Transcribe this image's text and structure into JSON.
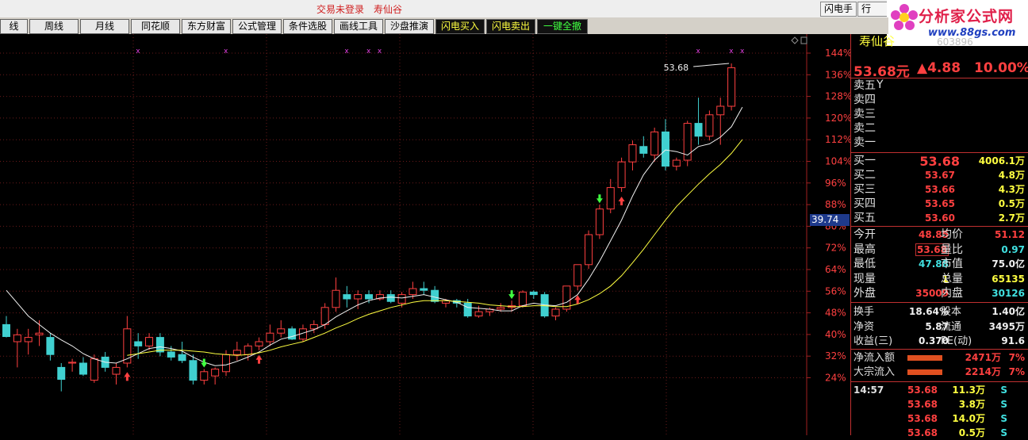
{
  "topbar": {
    "login_status": "交易未登录",
    "stock_name": "寿仙谷",
    "flash_hand_label": "闪电手",
    "row_label": "行"
  },
  "logo": {
    "name": "分析家公式网",
    "url": "www.88gs.com"
  },
  "toolbar": {
    "tabs": [
      "线",
      "周线",
      "月线",
      "同花顺",
      "东方财富",
      "公式管理",
      "条件选股",
      "画线工具",
      "沙盘推演",
      "闪电买入",
      "闪电卖出",
      "一键全撤"
    ]
  },
  "chart": {
    "current_price_label": "39.74",
    "peak_label": "53.68",
    "y_axis_pct": [
      "144%",
      "136%",
      "128%",
      "120%",
      "112%",
      "104%",
      "96%",
      "88%",
      "80%",
      "72%",
      "64%",
      "56%",
      "48%",
      "40%",
      "32%",
      "24%"
    ]
  },
  "colors": {
    "up": "#ff4040",
    "down": "#40d0d0",
    "ma5": "#f0f0f0",
    "ma10": "#ffff40",
    "grid": "#6a1a1a"
  },
  "chart_data": {
    "type": "candlestick",
    "candles": [
      {
        "o": 43.0,
        "h": 44.0,
        "l": 41.5,
        "c": 41.6
      },
      {
        "o": 41.0,
        "h": 42.5,
        "l": 38.0,
        "c": 41.8
      },
      {
        "o": 41.0,
        "h": 42.5,
        "l": 39.5,
        "c": 41.5
      },
      {
        "o": 41.8,
        "h": 43.5,
        "l": 40.5,
        "c": 42.0
      },
      {
        "o": 41.5,
        "h": 42.0,
        "l": 38.8,
        "c": 39.5
      },
      {
        "o": 38.0,
        "h": 38.5,
        "l": 35.2,
        "c": 36.6
      },
      {
        "o": 38.5,
        "h": 39.0,
        "l": 37.5,
        "c": 38.6
      },
      {
        "o": 38.5,
        "h": 39.2,
        "l": 37.0,
        "c": 37.2
      },
      {
        "o": 36.5,
        "h": 39.5,
        "l": 36.2,
        "c": 39.0
      },
      {
        "o": 39.2,
        "h": 39.8,
        "l": 37.5,
        "c": 38.0
      },
      {
        "o": 37.2,
        "h": 38.5,
        "l": 36.0,
        "c": 38.0
      },
      {
        "o": 38.5,
        "h": 44.0,
        "l": 38.0,
        "c": 42.5
      },
      {
        "o": 41.0,
        "h": 42.0,
        "l": 39.0,
        "c": 40.5
      },
      {
        "o": 40.5,
        "h": 42.0,
        "l": 40.0,
        "c": 41.5
      },
      {
        "o": 41.5,
        "h": 42.0,
        "l": 39.3,
        "c": 39.8
      },
      {
        "o": 39.8,
        "h": 40.5,
        "l": 38.8,
        "c": 39.2
      },
      {
        "o": 39.5,
        "h": 41.0,
        "l": 38.5,
        "c": 38.8
      },
      {
        "o": 38.8,
        "h": 39.5,
        "l": 36.0,
        "c": 36.5
      },
      {
        "o": 36.5,
        "h": 37.8,
        "l": 36.0,
        "c": 37.5
      },
      {
        "o": 37.0,
        "h": 38.0,
        "l": 36.0,
        "c": 37.8
      },
      {
        "o": 37.5,
        "h": 40.0,
        "l": 37.0,
        "c": 39.5
      },
      {
        "o": 39.5,
        "h": 41.0,
        "l": 38.8,
        "c": 40.0
      },
      {
        "o": 39.5,
        "h": 40.8,
        "l": 38.8,
        "c": 40.5
      },
      {
        "o": 40.5,
        "h": 41.5,
        "l": 40.0,
        "c": 41.0
      },
      {
        "o": 41.0,
        "h": 43.0,
        "l": 40.5,
        "c": 42.0
      },
      {
        "o": 42.0,
        "h": 43.5,
        "l": 41.5,
        "c": 42.5
      },
      {
        "o": 42.5,
        "h": 42.8,
        "l": 41.2,
        "c": 41.3
      },
      {
        "o": 41.3,
        "h": 43.0,
        "l": 41.0,
        "c": 42.5
      },
      {
        "o": 42.5,
        "h": 43.5,
        "l": 42.0,
        "c": 43.0
      },
      {
        "o": 43.0,
        "h": 45.5,
        "l": 42.5,
        "c": 45.0
      },
      {
        "o": 45.0,
        "h": 48.5,
        "l": 44.5,
        "c": 47.0
      },
      {
        "o": 46.5,
        "h": 47.5,
        "l": 45.0,
        "c": 46.0
      },
      {
        "o": 46.0,
        "h": 47.0,
        "l": 44.8,
        "c": 46.5
      },
      {
        "o": 46.5,
        "h": 47.0,
        "l": 45.5,
        "c": 46.0
      },
      {
        "o": 46.0,
        "h": 47.0,
        "l": 45.8,
        "c": 46.5
      },
      {
        "o": 46.5,
        "h": 47.0,
        "l": 45.5,
        "c": 45.7
      },
      {
        "o": 45.5,
        "h": 46.8,
        "l": 45.0,
        "c": 46.5
      },
      {
        "o": 46.5,
        "h": 48.0,
        "l": 46.0,
        "c": 47.2
      },
      {
        "o": 47.2,
        "h": 48.0,
        "l": 46.5,
        "c": 47.0
      },
      {
        "o": 47.0,
        "h": 47.5,
        "l": 45.5,
        "c": 45.7
      },
      {
        "o": 45.5,
        "h": 46.0,
        "l": 45.0,
        "c": 45.8
      },
      {
        "o": 45.8,
        "h": 46.0,
        "l": 45.0,
        "c": 45.5
      },
      {
        "o": 45.5,
        "h": 46.0,
        "l": 43.8,
        "c": 44.0
      },
      {
        "o": 44.0,
        "h": 45.2,
        "l": 43.8,
        "c": 44.5
      },
      {
        "o": 44.5,
        "h": 45.0,
        "l": 44.0,
        "c": 44.8
      },
      {
        "o": 44.8,
        "h": 45.5,
        "l": 44.5,
        "c": 45.0
      },
      {
        "o": 45.0,
        "h": 45.8,
        "l": 44.5,
        "c": 45.2
      },
      {
        "o": 45.2,
        "h": 47.0,
        "l": 45.0,
        "c": 46.8
      },
      {
        "o": 46.8,
        "h": 47.0,
        "l": 46.0,
        "c": 46.5
      },
      {
        "o": 46.5,
        "h": 46.8,
        "l": 43.8,
        "c": 44.0
      },
      {
        "o": 44.0,
        "h": 45.0,
        "l": 43.5,
        "c": 44.8
      },
      {
        "o": 44.8,
        "h": 47.5,
        "l": 44.5,
        "c": 47.5
      },
      {
        "o": 47.5,
        "h": 50.0,
        "l": 47.0,
        "c": 50.0
      },
      {
        "o": 50.0,
        "h": 54.0,
        "l": 49.5,
        "c": 53.5
      },
      {
        "o": 53.5,
        "h": 57.0,
        "l": 53.0,
        "c": 56.5
      },
      {
        "o": 56.5,
        "h": 60.0,
        "l": 56.0,
        "c": 59.0
      },
      {
        "o": 59.0,
        "h": 62.5,
        "l": 58.5,
        "c": 62.0
      },
      {
        "o": 62.0,
        "h": 64.5,
        "l": 61.0,
        "c": 64.0
      },
      {
        "o": 63.8,
        "h": 65.0,
        "l": 62.5,
        "c": 63.0
      },
      {
        "o": 62.8,
        "h": 66.0,
        "l": 62.0,
        "c": 65.5
      },
      {
        "o": 65.5,
        "h": 67.0,
        "l": 61.0,
        "c": 61.5
      },
      {
        "o": 61.5,
        "h": 62.5,
        "l": 61.0,
        "c": 62.2
      },
      {
        "o": 62.2,
        "h": 66.8,
        "l": 61.5,
        "c": 66.5
      },
      {
        "o": 66.5,
        "h": 69.5,
        "l": 64.0,
        "c": 65.0
      },
      {
        "o": 65.0,
        "h": 68.0,
        "l": 64.5,
        "c": 67.5
      },
      {
        "o": 67.5,
        "h": 69.5,
        "l": 64.0,
        "c": 68.5
      },
      {
        "o": 68.5,
        "h": 73.5,
        "l": 68.0,
        "c": 73.0
      }
    ],
    "ma5": [
      47,
      45.5,
      44,
      43,
      42,
      41.2,
      40.5,
      39.6,
      39.0,
      38.6,
      38.5,
      39.0,
      39.6,
      40.2,
      40.4,
      40.2,
      39.9,
      39.2,
      38.6,
      38.2,
      38.3,
      38.7,
      39.2,
      39.8,
      40.6,
      41.3,
      41.6,
      42.0,
      42.4,
      43.0,
      43.9,
      44.6,
      45.3,
      45.8,
      46.1,
      46.2,
      46.1,
      46.3,
      46.5,
      46.2,
      45.9,
      45.6,
      45.0,
      44.9,
      44.8,
      44.6,
      44.6,
      45.2,
      45.5,
      45.3,
      45.2,
      45.6,
      46.5,
      48.3,
      50.4,
      52.8,
      55.2,
      58.0,
      60.5,
      62.2,
      63.4,
      63.2,
      62.8,
      63.8,
      64.1,
      64.9,
      66.1,
      68.4
    ],
    "ma10": [
      null,
      null,
      null,
      null,
      null,
      null,
      null,
      null,
      null,
      null,
      null,
      39.4,
      39.6,
      39.8,
      40.0,
      40.0,
      40.0,
      39.9,
      39.8,
      39.6,
      39.5,
      39.4,
      39.5,
      39.7,
      40.0,
      40.4,
      40.7,
      41.0,
      41.5,
      42.0,
      42.6,
      43.1,
      43.7,
      44.2,
      44.6,
      45.0,
      45.3,
      45.6,
      45.8,
      45.8,
      45.8,
      45.7,
      45.6,
      45.5,
      45.3,
      45.2,
      45.1,
      45.1,
      45.2,
      45.2,
      45.1,
      45.1,
      45.4,
      45.9,
      46.6,
      47.5,
      48.7,
      50.2,
      51.8,
      53.5,
      55.2,
      56.8,
      58.1,
      59.4,
      60.6,
      61.7,
      63.0,
      64.6
    ]
  },
  "quote": {
    "name": "寿仙谷",
    "code": "603896",
    "price": "53.68元",
    "change": "▲4.88",
    "change_pct": "10.00%",
    "sell_labels": [
      "卖五",
      "卖四",
      "卖三",
      "卖二",
      "卖一"
    ],
    "sell5_extra": "Y",
    "buys": [
      {
        "label": "买一",
        "price": "53.68",
        "vol": "4006.1万"
      },
      {
        "label": "买二",
        "price": "53.67",
        "vol": "4.8万"
      },
      {
        "label": "买三",
        "price": "53.66",
        "vol": "4.3万"
      },
      {
        "label": "买四",
        "price": "53.65",
        "vol": "0.5万"
      },
      {
        "label": "买五",
        "price": "53.60",
        "vol": "2.7万"
      }
    ],
    "stats": [
      {
        "l1": "今开",
        "v1": "48.85",
        "l2": "均价",
        "v2": "51.12"
      },
      {
        "l1": "最高",
        "v1": "53.68",
        "l2": "量比",
        "v2": "0.97"
      },
      {
        "l1": "最低",
        "v1": "47.88",
        "l2": "市值",
        "v2": "75.0亿"
      },
      {
        "l1": "现量",
        "v1": "1",
        "l2": "总量",
        "v2": "65135"
      },
      {
        "l1": "外盘",
        "v1": "35009",
        "l2": "内盘",
        "v2": "30126"
      }
    ],
    "fin": [
      {
        "l1": "换手",
        "v1": "18.64%",
        "l2": "股本",
        "v2": "1.40亿"
      },
      {
        "l1": "净资",
        "v1": "5.87",
        "l2": "流通",
        "v2": "3495万"
      },
      {
        "l1": "收益(三)",
        "v1": "0.370",
        "l2": "PE(动)",
        "v2": "91.6"
      }
    ],
    "flows": [
      {
        "label": "净流入额",
        "value": "2471万",
        "pct": "7%"
      },
      {
        "label": "大宗流入",
        "value": "2214万",
        "pct": "7%"
      }
    ],
    "ticks": [
      {
        "time": "14:57",
        "price": "53.68",
        "vol": "11.3万",
        "side": "S"
      },
      {
        "time": "",
        "price": "53.68",
        "vol": "3.8万",
        "side": "S"
      },
      {
        "time": "",
        "price": "53.68",
        "vol": "14.0万",
        "side": "S"
      },
      {
        "time": "",
        "price": "53.68",
        "vol": "0.5万",
        "side": "S"
      }
    ]
  }
}
